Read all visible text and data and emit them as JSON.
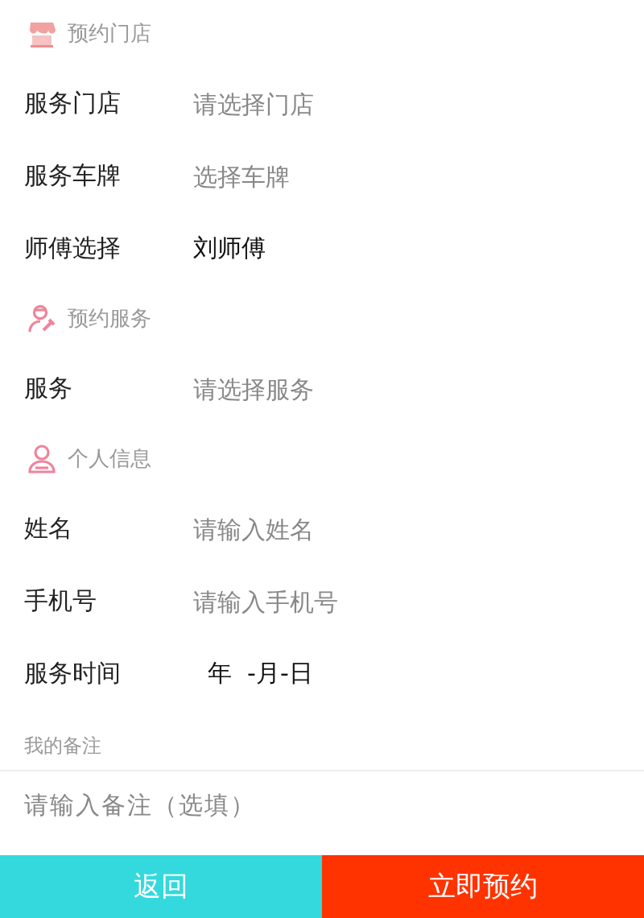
{
  "sections": [
    {
      "kind": "store",
      "title": "预约门店",
      "fields": [
        {
          "label": "服务门店",
          "placeholder": "请选择门店"
        },
        {
          "label": "服务车牌",
          "placeholder": "选择车牌"
        },
        {
          "label": "师傅选择",
          "value": "刘师傅"
        }
      ]
    },
    {
      "kind": "mechanic",
      "title": "预约服务",
      "fields": [
        {
          "label": "服务",
          "placeholder": "请选择服务"
        }
      ]
    },
    {
      "kind": "person",
      "title": "个人信息",
      "fields": [
        {
          "label": "姓名",
          "placeholder": "请输入姓名"
        },
        {
          "label": "手机号",
          "placeholder": "请输入手机号"
        },
        {
          "label": "服务时间",
          "value": "年  -月-日",
          "kind": "date"
        }
      ]
    }
  ],
  "notes": {
    "label": "我的备注",
    "placeholder": "请输入备注（选填）"
  },
  "buttons": [
    {
      "label": "返回",
      "kind": "back"
    },
    {
      "label": "立即预约",
      "kind": "submit"
    }
  ]
}
